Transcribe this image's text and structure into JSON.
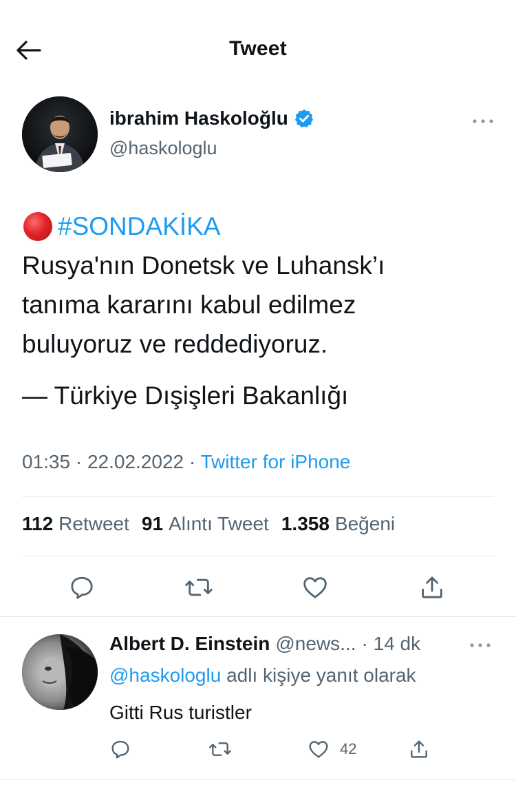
{
  "header": {
    "title": "Tweet"
  },
  "tweet": {
    "author_name": "ibrahim Haskoloğlu",
    "author_handle": "@haskologlu",
    "hashtag": "#SONDAKİKA",
    "lines": [
      "Rusya'nın Donetsk ve Luhansk’ı",
      "tanıma kararını kabul edilmez",
      "buluyoruz ve reddediyoruz."
    ],
    "attribution": "— Türkiye Dışişleri Bakanlığı",
    "time": "01:35",
    "date": "22.02.2022",
    "separator": "·",
    "source": "Twitter for iPhone"
  },
  "stats": {
    "retweets_count": "112",
    "retweets_label": "Retweet",
    "quotes_count": "91",
    "quotes_label": "Alıntı Tweet",
    "likes_count": "1.358",
    "likes_label": "Beğeni"
  },
  "reply": {
    "name": "Albert D. Einstein",
    "handle": "@news...",
    "time": "· 14 dk",
    "reply_to_mention": "@haskologlu",
    "reply_to_text": "adlı kişiye yanıt olarak",
    "text": "Gitti Rus turistler",
    "like_count": "42"
  },
  "icons": {
    "back": "arrow-left-icon",
    "verified": "verified-badge-icon",
    "more": "more-horizontal-icon",
    "reply": "comment-icon",
    "retweet": "retweet-icon",
    "like": "heart-icon",
    "share": "share-icon"
  },
  "colors": {
    "accent": "#1d9bf0",
    "text": "#0f1419",
    "muted": "#536471",
    "divider": "#e1e6ea",
    "red_circle": "#e0242a"
  }
}
